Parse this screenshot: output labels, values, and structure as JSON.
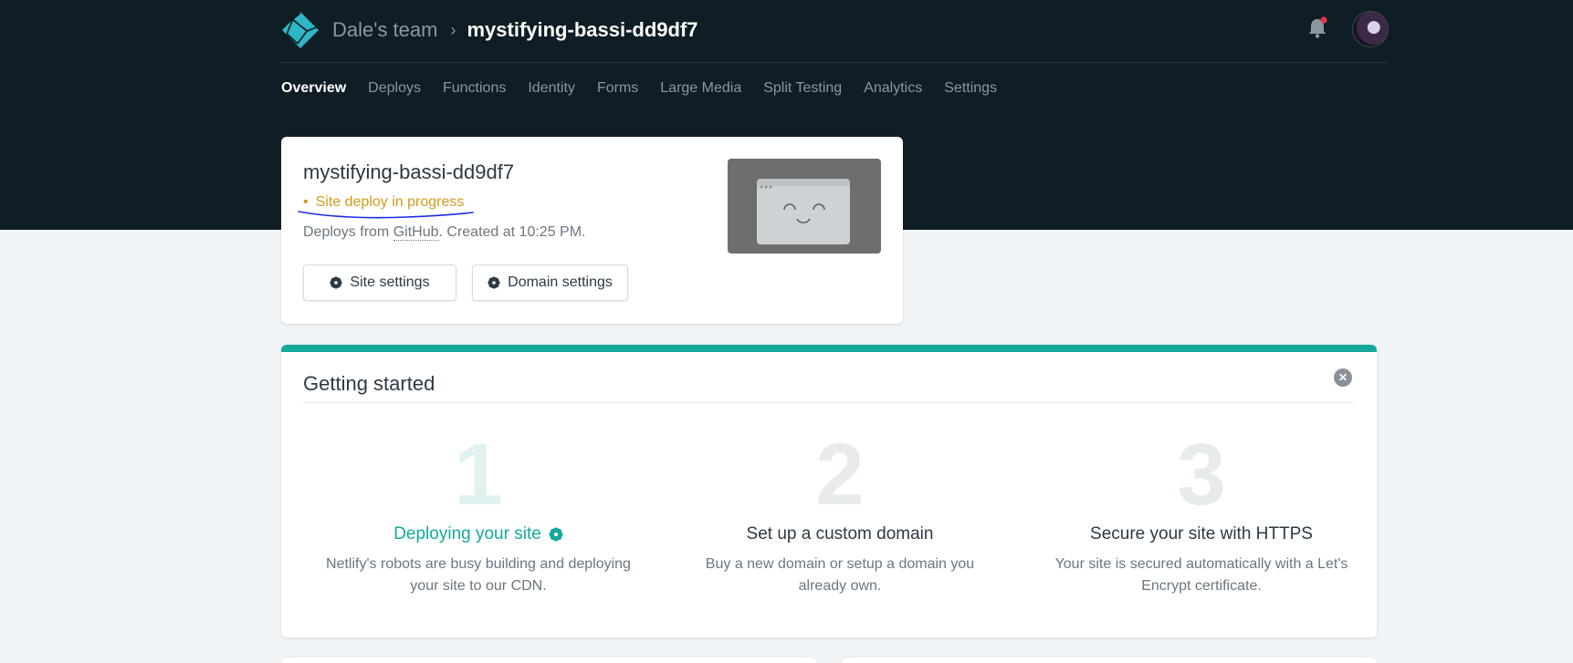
{
  "header": {
    "team": "Dale's team",
    "site": "mystifying-bassi-dd9df7",
    "logo_icon": "netlify-logo-icon",
    "notification_icon": "bell-icon",
    "avatar_icon": "user-avatar"
  },
  "nav": {
    "items": [
      {
        "label": "Overview",
        "active": true
      },
      {
        "label": "Deploys"
      },
      {
        "label": "Functions"
      },
      {
        "label": "Identity"
      },
      {
        "label": "Forms"
      },
      {
        "label": "Large Media"
      },
      {
        "label": "Split Testing"
      },
      {
        "label": "Analytics"
      },
      {
        "label": "Settings"
      }
    ]
  },
  "site_card": {
    "name": "mystifying-bassi-dd9df7",
    "status_dot": "•",
    "status": "Site deploy in progress",
    "deploy_prefix": "Deploys from ",
    "deploy_source": "GitHub",
    "deploy_suffix": ". Created at 10:25 PM.",
    "site_settings_label": "Site settings",
    "domain_settings_label": "Domain settings"
  },
  "getting_started": {
    "title": "Getting started",
    "close_icon": "close-icon",
    "steps": [
      {
        "number": "1",
        "title": "Deploying your site",
        "desc": "Netlify's robots are busy building and deploying your site to our CDN."
      },
      {
        "number": "2",
        "title": "Set up a custom domain",
        "desc": "Buy a new domain or setup a domain you already own."
      },
      {
        "number": "3",
        "title": "Secure your site with HTTPS",
        "desc": "Your site is secured automatically with a Let's Encrypt certificate."
      }
    ]
  },
  "colors": {
    "header_bg": "#0f1d24",
    "accent": "#14a99a",
    "status": "#d29a1a",
    "notification_dot": "#e4344d"
  }
}
